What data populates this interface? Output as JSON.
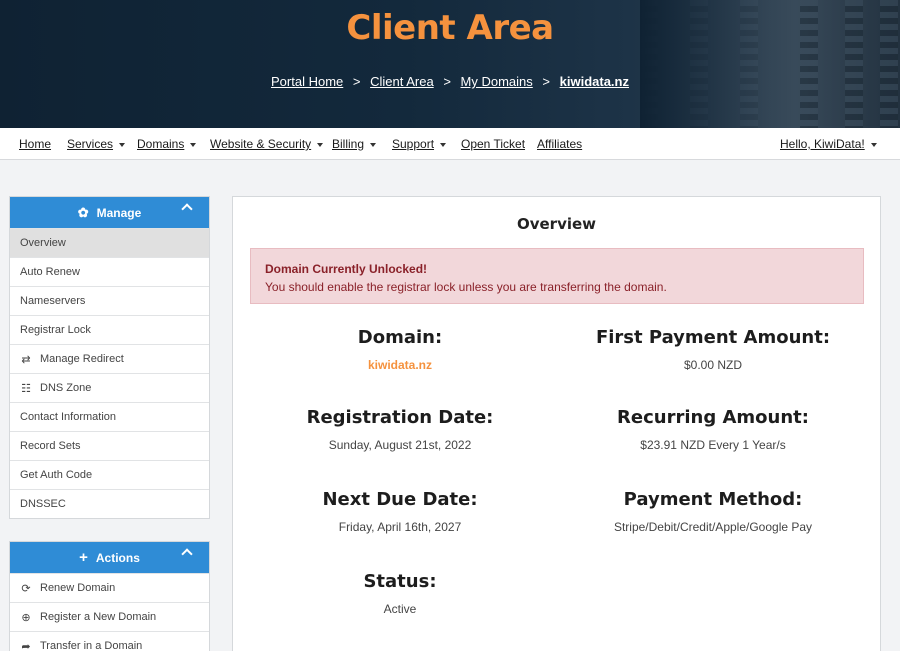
{
  "header": {
    "title": "Client Area",
    "breadcrumb": [
      {
        "label": "Portal Home"
      },
      {
        "label": "Client Area"
      },
      {
        "label": "My Domains"
      },
      {
        "label": "kiwidata.nz"
      }
    ],
    "separator": ">"
  },
  "nav": {
    "items": [
      {
        "label": "Home",
        "dropdown": false
      },
      {
        "label": "Services",
        "dropdown": true
      },
      {
        "label": "Domains",
        "dropdown": true
      },
      {
        "label": "Website & Security",
        "dropdown": true
      },
      {
        "label": "Billing",
        "dropdown": true
      },
      {
        "label": "Support",
        "dropdown": true
      },
      {
        "label": "Open Ticket",
        "dropdown": false
      },
      {
        "label": "Affiliates",
        "dropdown": false
      }
    ],
    "user": {
      "label": "Hello, KiwiData!",
      "dropdown": true
    }
  },
  "sidebar": {
    "manage": {
      "title": "Manage",
      "icon": "gear-icon",
      "items": [
        {
          "label": "Overview",
          "active": true,
          "icon": ""
        },
        {
          "label": "Auto Renew",
          "icon": ""
        },
        {
          "label": "Nameservers",
          "icon": ""
        },
        {
          "label": "Registrar Lock",
          "icon": ""
        },
        {
          "label": "Manage Redirect",
          "icon": "exchange-icon"
        },
        {
          "label": "DNS Zone",
          "icon": "sitemap-icon"
        },
        {
          "label": "Contact Information",
          "icon": ""
        },
        {
          "label": "Record Sets",
          "icon": ""
        },
        {
          "label": "Get Auth Code",
          "icon": ""
        },
        {
          "label": "DNSSEC",
          "icon": ""
        }
      ]
    },
    "actions": {
      "title": "Actions",
      "icon": "plus-icon",
      "items": [
        {
          "label": "Renew Domain",
          "icon": "refresh-icon"
        },
        {
          "label": "Register a New Domain",
          "icon": "globe-icon"
        },
        {
          "label": "Transfer in a Domain",
          "icon": "share-icon"
        }
      ]
    }
  },
  "overview": {
    "title": "Overview",
    "alert": {
      "title": "Domain Currently Unlocked!",
      "message": "You should enable the registrar lock unless you are transferring the domain."
    },
    "fields": {
      "domain": {
        "label": "Domain:",
        "value": "kiwidata.nz"
      },
      "first_payment": {
        "label": "First Payment Amount:",
        "value": "$0.00 NZD"
      },
      "registration_date": {
        "label": "Registration Date:",
        "value": "Sunday, August 21st, 2022"
      },
      "recurring_amount": {
        "label": "Recurring Amount:",
        "value": "$23.91 NZD Every 1 Year/s"
      },
      "next_due_date": {
        "label": "Next Due Date:",
        "value": "Friday, April 16th, 2027"
      },
      "payment_method": {
        "label": "Payment Method:",
        "value": "Stripe/Debit/Credit/Apple/Google Pay"
      },
      "status": {
        "label": "Status:",
        "value": "Active"
      }
    }
  },
  "colors": {
    "accent_orange": "#f5923e",
    "panel_blue": "#2f8cd6",
    "alert_bg": "#f2d7da",
    "alert_text": "#8a2129"
  }
}
